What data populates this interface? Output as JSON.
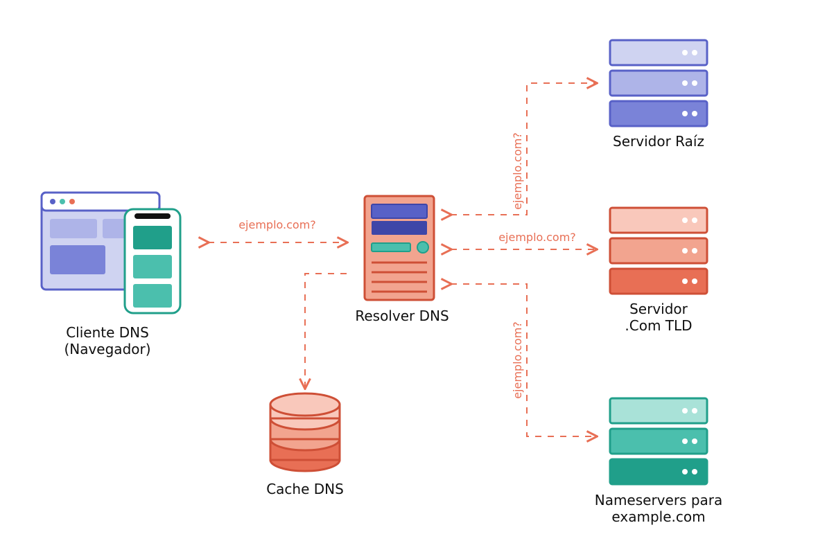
{
  "nodes": {
    "client": {
      "title": "Cliente DNS",
      "subtitle": "(Navegador)"
    },
    "resolver": {
      "title": "Resolver DNS"
    },
    "cache": {
      "title": "Cache DNS"
    },
    "root": {
      "title": "Servidor Raíz"
    },
    "tld": {
      "title": "Servidor",
      "subtitle": ".Com TLD"
    },
    "ns": {
      "title": "Nameservers para",
      "subtitle": "example.com"
    }
  },
  "query": "ejemplo.com?",
  "colors": {
    "orange": "#e86f55",
    "orange_light": "#f2a48f",
    "orange_pale": "#f9c8bb",
    "blue": "#5861c7",
    "blue_mid": "#7a83d8",
    "blue_light": "#aeb4e8",
    "blue_pale": "#cfd3f1",
    "teal": "#209f8a",
    "teal_mid": "#4bbfad",
    "teal_light": "#a9e2d8",
    "text": "#0f0f0f"
  }
}
